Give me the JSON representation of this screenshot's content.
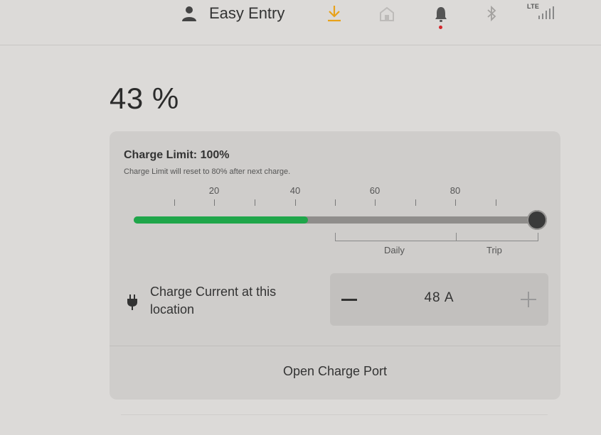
{
  "topbar": {
    "profile_name": "Easy Entry",
    "profile_icon": "person-icon",
    "download_icon": "download-icon",
    "home_icon": "home-icon",
    "bell_icon": "bell-icon",
    "bluetooth_icon": "bluetooth-icon",
    "network_label": "LTE",
    "signal_icon": "signal-bars-icon",
    "accent_color": "#e8a21a",
    "notification_color": "#d3262b"
  },
  "battery": {
    "percent_label": "43 %"
  },
  "charge_limit": {
    "title": "Charge Limit: 100%",
    "note": "Charge Limit will reset to 80% after next charge.",
    "scale_labels": [
      "20",
      "40",
      "60",
      "80"
    ],
    "current_charge_fraction": 0.43,
    "limit_fraction": 1.0,
    "fill_color": "#1fa64a",
    "daily_label": "Daily",
    "trip_label": "Trip"
  },
  "charge_current": {
    "label": "Charge Current at this location",
    "value": "48  A",
    "minus_label": "−",
    "plus_label": "+",
    "plug_icon": "plug-icon"
  },
  "open_port": {
    "label": "Open Charge Port"
  }
}
